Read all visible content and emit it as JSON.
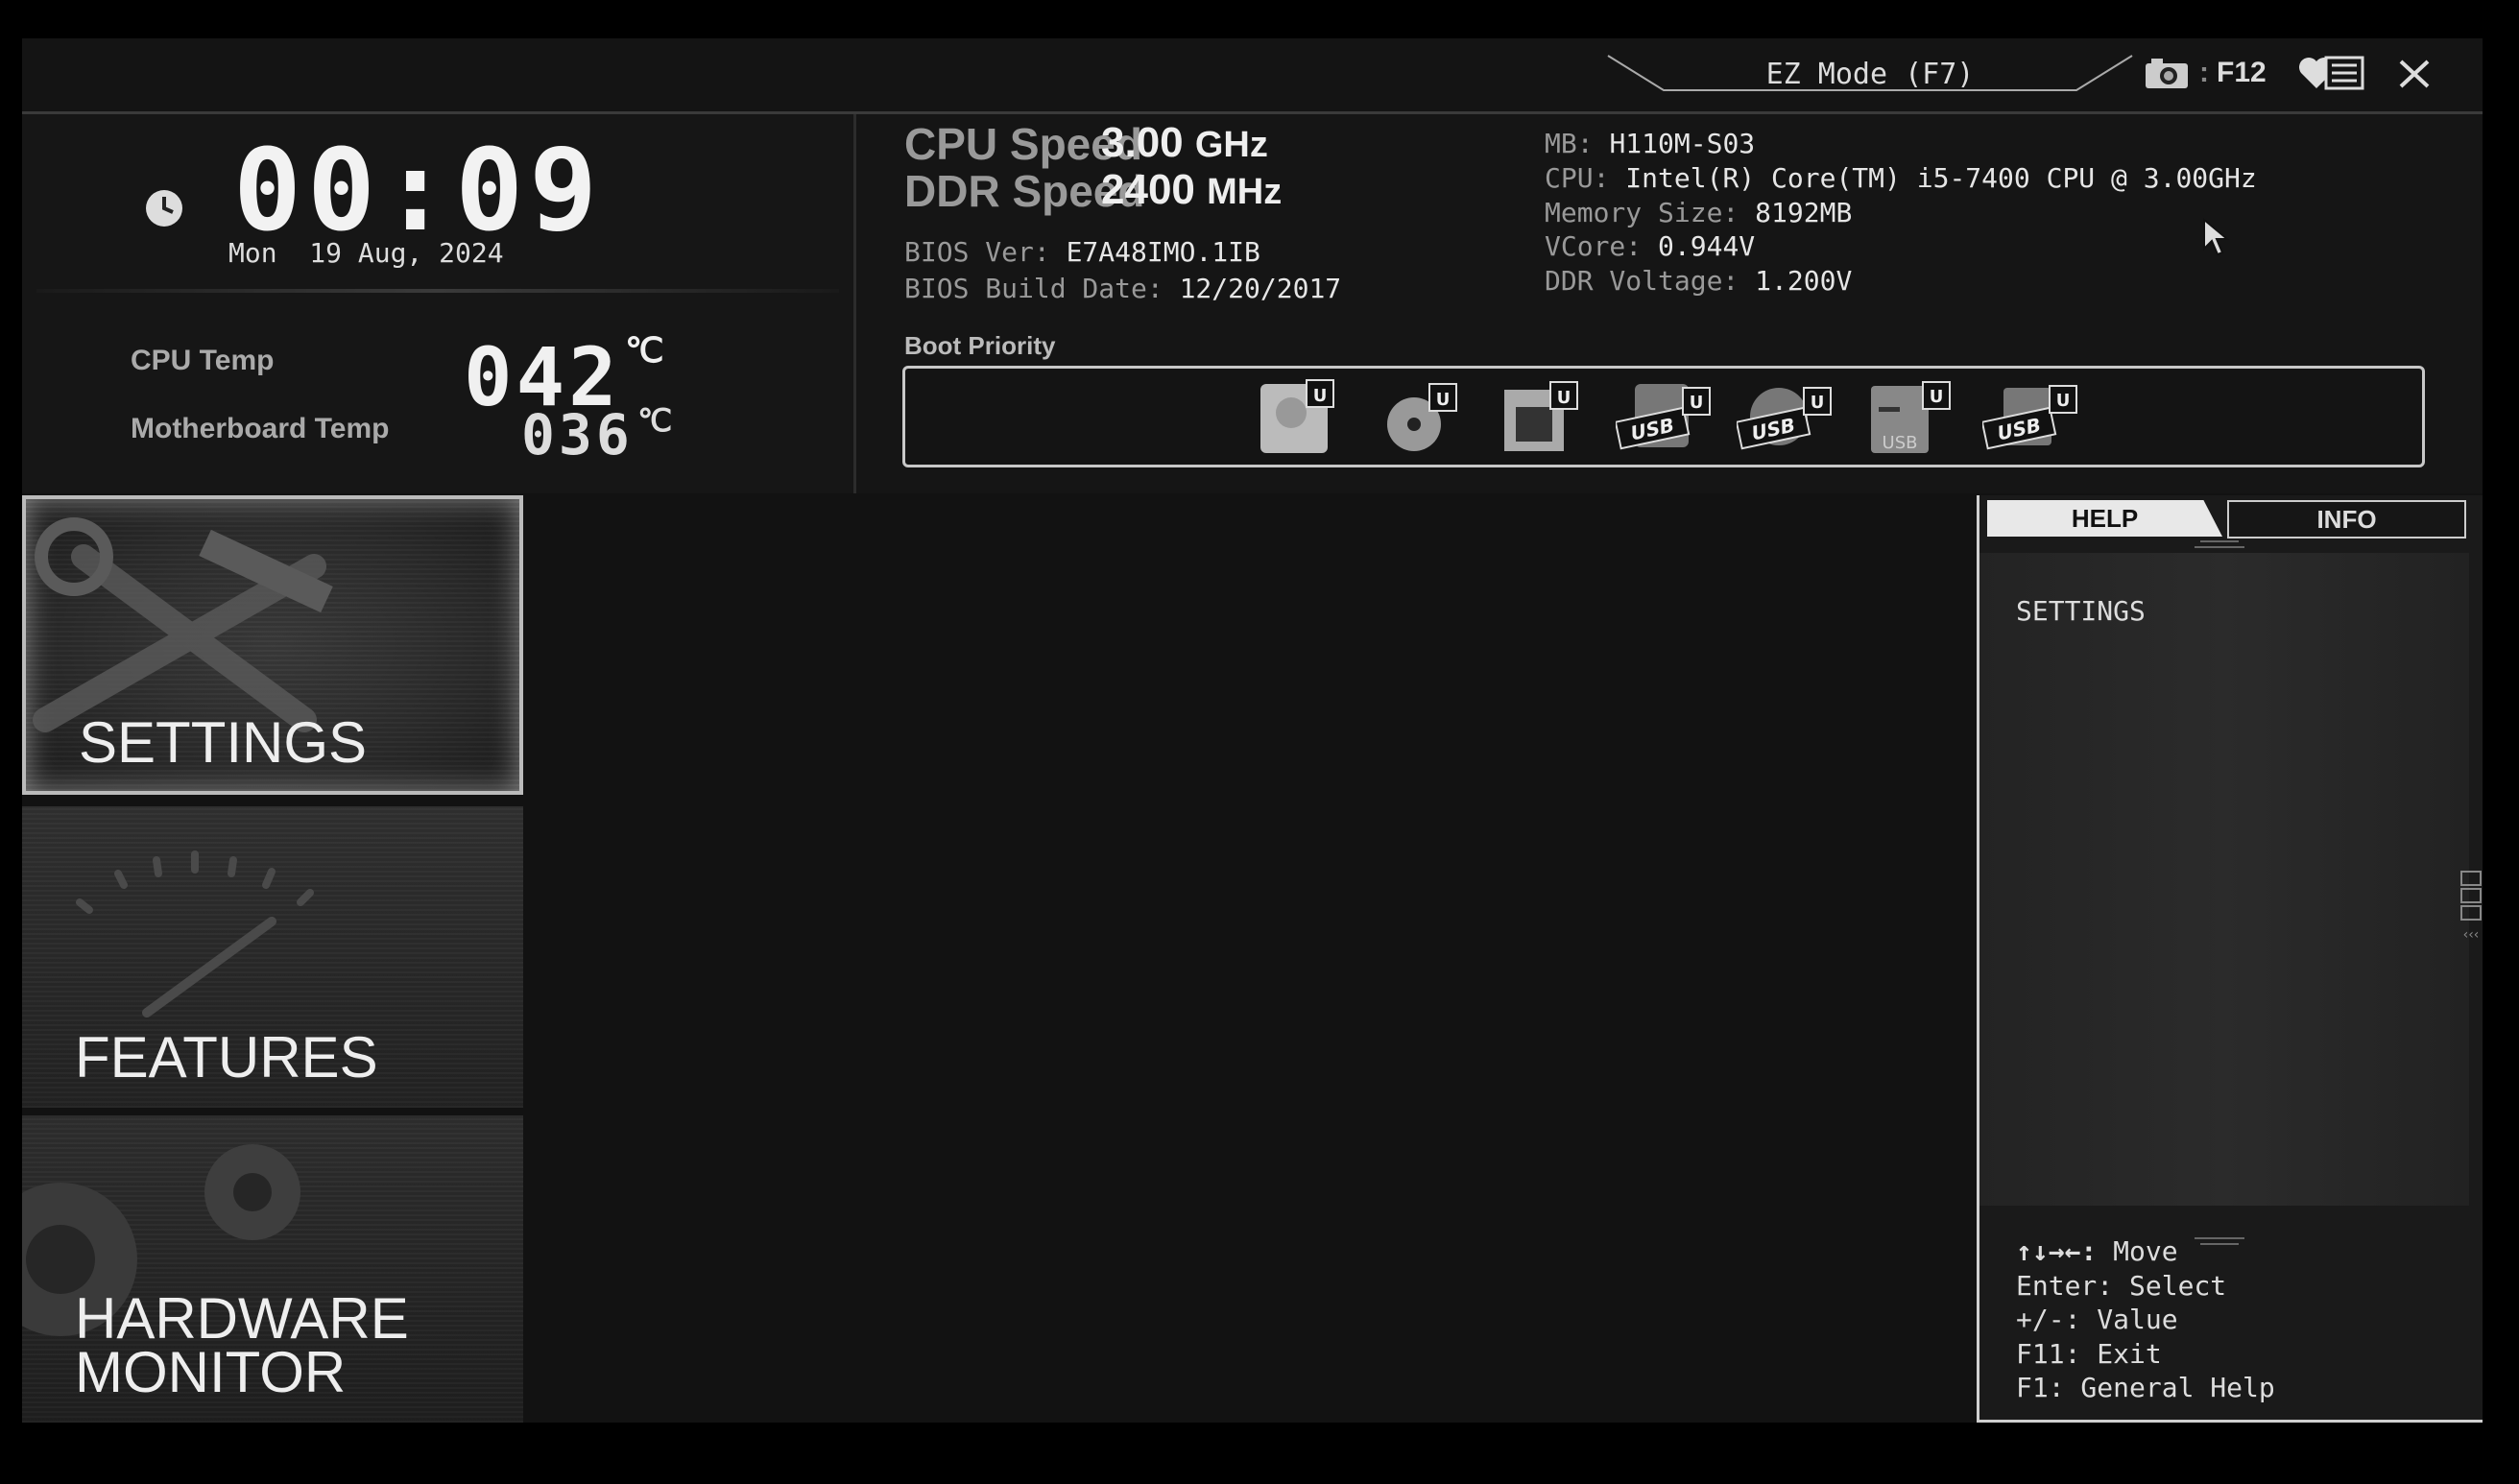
{
  "topbar": {
    "ez_mode_label": "EZ Mode (F7)",
    "screenshot_key": "F12"
  },
  "clock": {
    "time": "00:09",
    "date": "Mon  19 Aug, 2024"
  },
  "temps": {
    "cpu_label": "CPU Temp",
    "cpu_value": "042",
    "mb_label": "Motherboard Temp",
    "mb_value": "036",
    "unit": "℃"
  },
  "speeds": {
    "cpu_label": "CPU Speed",
    "cpu_value": "3.00",
    "cpu_unit": "GHz",
    "ddr_label": "DDR Speed",
    "ddr_value": "2400",
    "ddr_unit": "MHz"
  },
  "bios": {
    "ver_label": "BIOS Ver: ",
    "ver_value": "E7A48IMO.1IB",
    "date_label": "BIOS Build Date: ",
    "date_value": "12/20/2017"
  },
  "system": {
    "mb_label": "MB: ",
    "mb_value": "H110M-S03",
    "cpu_label": "CPU: ",
    "cpu_value": "Intel(R) Core(TM) i5-7400 CPU @ 3.00GHz",
    "mem_label": "Memory Size: ",
    "mem_value": "8192MB",
    "vcore_label": "VCore: ",
    "vcore_value": "0.944V",
    "ddrv_label": "DDR Voltage: ",
    "ddrv_value": "1.200V"
  },
  "boot": {
    "label": "Boot Priority",
    "devices": [
      {
        "type": "hdd",
        "badge": "U"
      },
      {
        "type": "optical",
        "badge": "U"
      },
      {
        "type": "lan",
        "badge": "U"
      },
      {
        "type": "usb-hdd",
        "badge": "U",
        "text": "USB"
      },
      {
        "type": "usb-optical",
        "badge": "U",
        "text": "USB"
      },
      {
        "type": "usb-key",
        "badge": "U",
        "text": "USB"
      },
      {
        "type": "usb-drive",
        "badge": "U",
        "text": "USB"
      }
    ]
  },
  "menu": {
    "settings": "SETTINGS",
    "features": "FEATURES",
    "hardware_1": "HARDWARE",
    "hardware_2": "MONITOR"
  },
  "help": {
    "tab_help": "HELP",
    "tab_info": "INFO",
    "content": "SETTINGS",
    "keys": [
      {
        "key": "↑↓→←:",
        "action": " Move"
      },
      {
        "key": "Enter:",
        "action": " Select"
      },
      {
        "key": "+/-:",
        "action": " Value"
      },
      {
        "key": "F11:",
        "action": " Exit"
      },
      {
        "key": "F1:",
        "action": " General Help"
      }
    ]
  },
  "colors": {
    "background": "#121212",
    "text": "#dddddd",
    "muted": "#999999",
    "border": "#c8c8c8"
  }
}
